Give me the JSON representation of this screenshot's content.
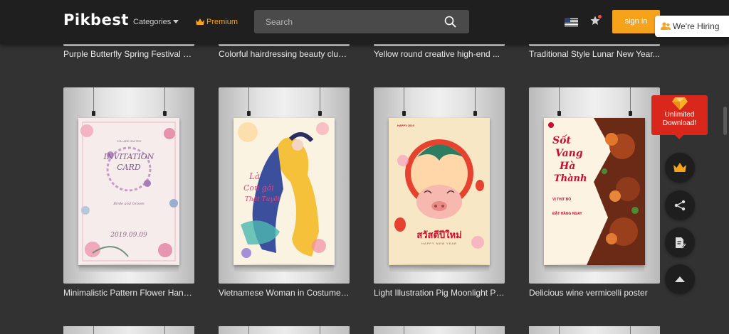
{
  "header": {
    "logo": "Pikbest",
    "categories_label": "Categories",
    "premium_label": "Premium",
    "search_placeholder": "Search",
    "signin_label": "sign in",
    "hiring_label": "We're Hiring"
  },
  "top_row": [
    {
      "title": "Purple Butterfly Spring Festival P..."
    },
    {
      "title": "Colorful hairdressing beauty club..."
    },
    {
      "title": "Yellow round creative high-end ..."
    },
    {
      "title": "Traditional Style Lunar New Year..."
    }
  ],
  "cards": [
    {
      "title": "Minimalistic Pattern Flower Hand...",
      "poster_main": "INVITATION",
      "poster_sub": "CARD",
      "poster_date": "2019.09.09",
      "poster_small": "Bride and Groom",
      "poster_top": "YOU ARE INVITED"
    },
    {
      "title": "Vietnamese Woman in Costume ...",
      "poster_main": "Là",
      "poster_sub": "Con gái",
      "poster_small": "Thật Tuyệt"
    },
    {
      "title": "Light Illustration Pig Moonlight Pl...",
      "poster_main": "สวัสดีปีใหม่",
      "poster_small": "HAPPY NEW YEAR",
      "poster_top": "HAPPY 2019"
    },
    {
      "title": "Delicious wine vermicelli poster",
      "poster_main": "Sốt",
      "poster_sub": "Vang",
      "poster_line3": "Hà",
      "poster_line4": "Thành",
      "poster_item1": "VỊ THỊT BÒ",
      "poster_item2": "ĐẶT HÀNG NGAY"
    }
  ],
  "side": {
    "unlimited_line1": "Unlimited",
    "unlimited_line2": "Download!"
  },
  "colors": {
    "accent": "#f7a21b",
    "background": "#323232",
    "header": "#1f1f1f",
    "badge_red": "#d9271c"
  }
}
